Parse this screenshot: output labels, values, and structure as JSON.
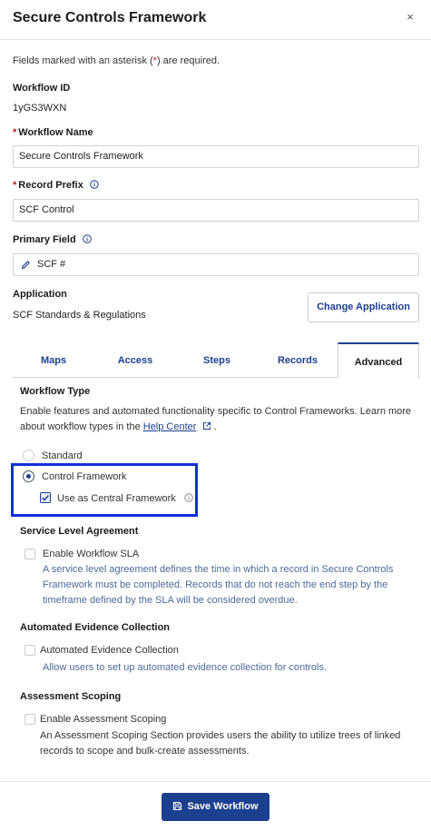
{
  "header": {
    "title": "Secure Controls Framework",
    "close_icon": "×"
  },
  "required_note": {
    "prefix": "Fields marked with an asterisk (",
    "star": "*",
    "suffix": ") are required."
  },
  "workflow_id": {
    "label": "Workflow ID",
    "value": "1yGS3WXN"
  },
  "workflow_name": {
    "label": "Workflow Name",
    "star": "*",
    "value": "Secure Controls Framework"
  },
  "record_prefix": {
    "label": "Record Prefix",
    "star": "*",
    "value": "SCF Control"
  },
  "primary_field": {
    "label": "Primary Field",
    "value": "SCF #"
  },
  "application": {
    "label": "Application",
    "value": "SCF Standards & Regulations",
    "change_button": "Change Application"
  },
  "tabs": [
    {
      "label": "Maps"
    },
    {
      "label": "Access"
    },
    {
      "label": "Steps"
    },
    {
      "label": "Records"
    },
    {
      "label": "Advanced"
    }
  ],
  "workflow_type": {
    "title": "Workflow Type",
    "desc_line1": "Enable features and automated functionality specific to Control Frameworks. Learn more",
    "desc_line2_prefix": "about workflow types in the ",
    "help_link": "Help Center",
    "desc_line2_suffix": ".",
    "options": [
      {
        "label": "Standard"
      },
      {
        "label": "Control Framework"
      }
    ],
    "central_framework_label": "Use as Central Framework"
  },
  "sla": {
    "title": "Service Level Agreement",
    "checkbox_label": "Enable Workflow SLA",
    "desc_line1": "A service level agreement defines the time in which a record in Secure Controls",
    "desc_line2": "Framework must be completed. Records that do not reach the end step by the",
    "desc_line3": "timeframe defined by the SLA will be considered overdue."
  },
  "evidence": {
    "title": "Automated Evidence Collection",
    "checkbox_label": "Automated Evidence Collection",
    "desc": "Allow users to set up automated evidence collection for controls."
  },
  "scoping": {
    "title": "Assessment Scoping",
    "checkbox_label": "Enable Assessment Scoping",
    "desc_line1": "An Assessment Scoping Section provides users the ability to utilize trees of linked",
    "desc_line2": "records to scope and bulk-create assessments."
  },
  "footer": {
    "save_button": "Save Workflow"
  }
}
